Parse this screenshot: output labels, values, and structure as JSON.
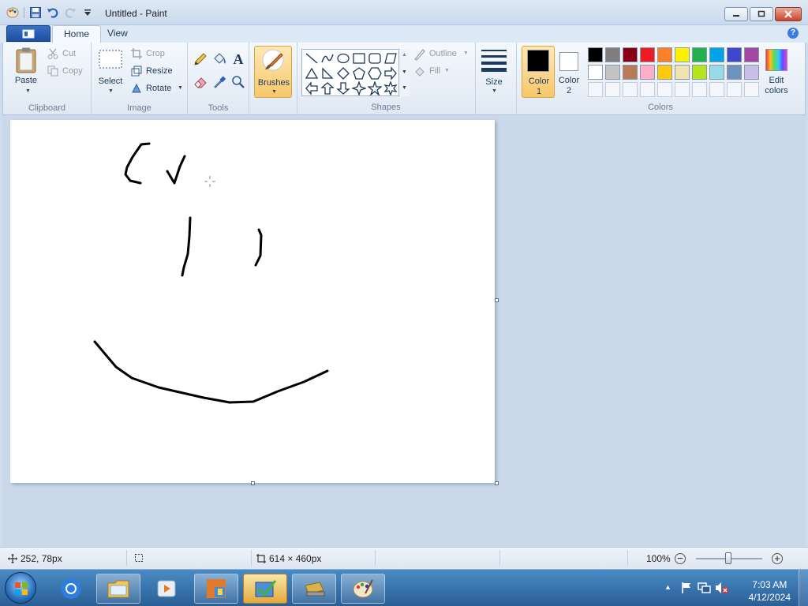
{
  "window": {
    "title": "Untitled - Paint"
  },
  "tabs": {
    "home": "Home",
    "view": "View"
  },
  "ribbon": {
    "clipboard": {
      "label": "Clipboard",
      "paste": "Paste",
      "cut": "Cut",
      "copy": "Copy"
    },
    "image": {
      "label": "Image",
      "select": "Select",
      "crop": "Crop",
      "resize": "Resize",
      "rotate": "Rotate"
    },
    "tools": {
      "label": "Tools",
      "text_tool": "A"
    },
    "brushes": {
      "label": "Brushes"
    },
    "shapes": {
      "label": "Shapes",
      "outline": "Outline",
      "fill": "Fill"
    },
    "size": {
      "label": "Size"
    },
    "colors": {
      "label": "Colors",
      "color1_line1": "Color",
      "color1_line2": "1",
      "color2_line1": "Color",
      "color2_line2": "2",
      "edit_line1": "Edit",
      "edit_line2": "colors",
      "color1": "#000000",
      "color2": "#ffffff",
      "row1": [
        "#000000",
        "#7f7f7f",
        "#880015",
        "#ed1c24",
        "#ff7f27",
        "#fff200",
        "#22b14c",
        "#00a2e8",
        "#3f48cc",
        "#a349a4"
      ],
      "row2": [
        "#ffffff",
        "#c3c3c3",
        "#b97a57",
        "#ffaec9",
        "#ffc90e",
        "#efe4b0",
        "#b5e61d",
        "#99d9ea",
        "#7092be",
        "#c8bfe7"
      ]
    }
  },
  "status": {
    "cursor_pos": "252, 78px",
    "image_size": "614 × 460px",
    "zoom": "100%"
  },
  "taskbar": {
    "time": "7:03 AM",
    "date": "4/12/2024"
  }
}
